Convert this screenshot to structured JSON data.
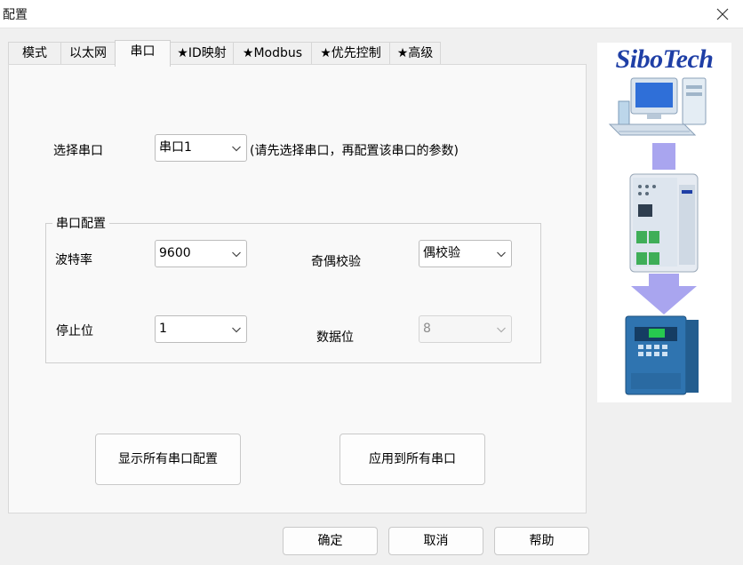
{
  "window": {
    "title": "配置"
  },
  "tabs": [
    {
      "label": "模式"
    },
    {
      "label": "以太网"
    },
    {
      "label": "串口"
    },
    {
      "label": "★ID映射"
    },
    {
      "label": "★Modbus"
    },
    {
      "label": "★优先控制"
    },
    {
      "label": "★高级"
    }
  ],
  "port_select": {
    "label": "选择串口",
    "value": "串口1",
    "hint": "(请先选择串口，再配置该串口的参数)"
  },
  "serial_config": {
    "group_title": "串口配置",
    "baud_rate": {
      "label": "波特率",
      "value": "9600"
    },
    "parity": {
      "label": "奇偶校验",
      "value": "偶校验"
    },
    "stop_bits": {
      "label": "停止位",
      "value": "1"
    },
    "data_bits": {
      "label": "数据位",
      "value": "8"
    }
  },
  "actions": {
    "show_all": "显示所有串口配置",
    "apply_all": "应用到所有串口"
  },
  "footer": {
    "ok": "确定",
    "cancel": "取消",
    "help": "帮助"
  },
  "brand": {
    "logo_text": "SiboTech"
  },
  "colors": {
    "logo": "#1f3fa6",
    "arrow": "#a9a5ef",
    "window_bg": "#f0f0f0",
    "panel_bg": "#f9f9f9"
  }
}
